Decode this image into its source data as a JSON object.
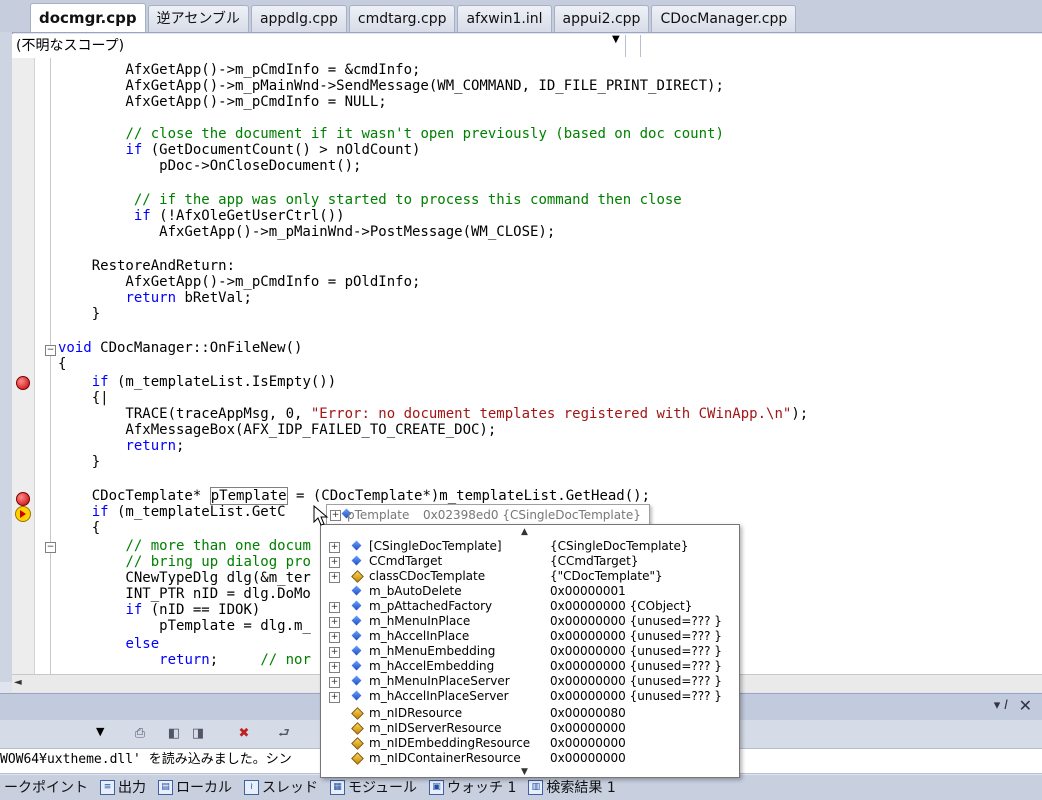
{
  "tabs": [
    {
      "label": "docmgr.cpp",
      "active": true
    },
    {
      "label": "逆アセンブル",
      "active": false
    },
    {
      "label": "appdlg.cpp",
      "active": false
    },
    {
      "label": "cmdtarg.cpp",
      "active": false
    },
    {
      "label": "afxwin1.inl",
      "active": false
    },
    {
      "label": "appui2.cpp",
      "active": false
    },
    {
      "label": "CDocManager.cpp",
      "active": false
    }
  ],
  "scope": {
    "value": "(不明なスコープ)"
  },
  "code": {
    "l1": "        AfxGetApp()->m_pCmdInfo = &cmdInfo;",
    "l2": "        AfxGetApp()->m_pMainWnd->SendMessage(WM_COMMAND, ID_FILE_PRINT_DIRECT);",
    "l3": "        AfxGetApp()->m_pCmdInfo = NULL;",
    "l4_indent": "        ",
    "l4_comment": "// close the document if it wasn't open previously (based on doc count)",
    "l5_indent": "        ",
    "l5_kw": "if",
    "l5_rest": " (GetDocumentCount() > nOldCount)",
    "l6": "            pDoc->OnCloseDocument();",
    "l7_indent": "         ",
    "l7_comment": "// if the app was only started to process this command then close",
    "l8_indent": "         ",
    "l8_kw": "if",
    "l8_rest": " (!AfxOleGetUserCtrl())",
    "l9": "            AfxGetApp()->m_pMainWnd->PostMessage(WM_CLOSE);",
    "l10": "    RestoreAndReturn:",
    "l11": "        AfxGetApp()->m_pCmdInfo = pOldInfo;",
    "l12_indent": "        ",
    "l12_kw": "return",
    "l12_rest": " bRetVal;",
    "l13": "    }",
    "l14_kw": "void",
    "l14_rest": " CDocManager::OnFileNew()",
    "l15": "{",
    "l16_indent": "    ",
    "l16_kw": "if",
    "l16_rest": " (m_templateList.IsEmpty())",
    "l17": "    {|",
    "l18_pre": "        TRACE(traceAppMsg, 0, ",
    "l18_str": "\"Error: no document templates registered with CWinApp.\\n\"",
    "l18_post": ");",
    "l19": "        AfxMessageBox(AFX_IDP_FAILED_TO_CREATE_DOC);",
    "l20_indent": "        ",
    "l20_kw": "return",
    "l20_rest": ";",
    "l21": "    }",
    "l22_pre": "    CDocTemplate* ",
    "l22_hl": "pTemplate",
    "l22_post": " = (CDocTemplate*)m_templateList.GetHead();",
    "l23_indent": "    ",
    "l23_kw": "if",
    "l23_rest": " (m_templateList.GetC",
    "l24": "    {",
    "l25_indent": "        ",
    "l25_comment": "// more than one docum",
    "l26_indent": "        ",
    "l26_comment": "// bring up dialog pro",
    "l27": "        CNewTypeDlg dlg(&m_ter",
    "l28": "        INT_PTR nID = dlg.DoMo",
    "l29_indent": "        ",
    "l29_kw": "if",
    "l29_rest": " (nID == IDOK)",
    "l30": "            pTemplate = dlg.m_",
    "l31_indent": "        ",
    "l31_kw": "else",
    "l32_indent": "            ",
    "l32_kw": "return",
    "l32_rest": ";     ",
    "l32_comment": "// nor"
  },
  "datatip": {
    "header_name": "pTemplate",
    "header_value": "0x02398ed0 {CSingleDocTemplate}",
    "rows": [
      {
        "name": "[CSingleDocTemplate]",
        "value": "{CSingleDocTemplate}",
        "icon": "field-icon",
        "expand": true
      },
      {
        "name": "CCmdTarget",
        "value": "{CCmdTarget}",
        "icon": "field-icon",
        "expand": true
      },
      {
        "name": "classCDocTemplate",
        "value": "{\"CDocTemplate\"}",
        "icon": "static-field-icon",
        "expand": true
      },
      {
        "name": "m_bAutoDelete",
        "value": "0x00000001",
        "icon": "field-icon",
        "expand": false
      },
      {
        "name": "m_pAttachedFactory",
        "value": "0x00000000 {CObject}",
        "icon": "field-icon",
        "expand": true
      },
      {
        "name": "m_hMenuInPlace",
        "value": "0x00000000 {unused=??? }",
        "icon": "field-icon",
        "expand": true
      },
      {
        "name": "m_hAccelInPlace",
        "value": "0x00000000 {unused=??? }",
        "icon": "field-icon",
        "expand": true
      },
      {
        "name": "m_hMenuEmbedding",
        "value": "0x00000000 {unused=??? }",
        "icon": "field-icon",
        "expand": true
      },
      {
        "name": "m_hAccelEmbedding",
        "value": "0x00000000 {unused=??? }",
        "icon": "field-icon",
        "expand": true
      },
      {
        "name": "m_hMenuInPlaceServer",
        "value": "0x00000000 {unused=??? }",
        "icon": "field-icon",
        "expand": true
      },
      {
        "name": "m_hAccelInPlaceServer",
        "value": "0x00000000 {unused=??? }",
        "icon": "field-icon",
        "expand": true
      },
      {
        "name": "m_nIDResource",
        "value": "0x00000080",
        "icon": "static-field-icon",
        "expand": false
      },
      {
        "name": "m_nIDServerResource",
        "value": "0x00000000",
        "icon": "static-field-icon",
        "expand": false
      },
      {
        "name": "m_nIDEmbeddingResource",
        "value": "0x00000000",
        "icon": "static-field-icon",
        "expand": false
      },
      {
        "name": "m_nIDContainerResource",
        "value": "0x00000000",
        "icon": "static-field-icon",
        "expand": false
      }
    ]
  },
  "output": {
    "text": "WOW64¥uxtheme.dll' を読み込みました。シン"
  },
  "bottom_tabs": [
    {
      "label": "ークポイント",
      "icon": "breakpoints-icon"
    },
    {
      "label": "出力",
      "icon": "output-icon"
    },
    {
      "label": "ローカル",
      "icon": "locals-icon"
    },
    {
      "label": "スレッド",
      "icon": "threads-icon"
    },
    {
      "label": "モジュール",
      "icon": "modules-icon"
    },
    {
      "label": "ウォッチ 1",
      "icon": "watch-icon"
    },
    {
      "label": "検索結果 1",
      "icon": "find-results-icon"
    }
  ],
  "colors": {
    "keyword": "#0000ff",
    "comment": "#008000",
    "string": "#a31515",
    "breakpoint": "#c00000"
  }
}
